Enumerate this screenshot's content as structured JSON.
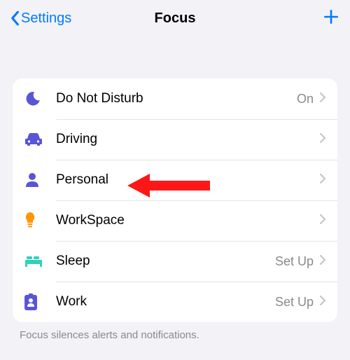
{
  "nav": {
    "back": "Settings",
    "title": "Focus"
  },
  "rows": [
    {
      "label": "Do Not Disturb",
      "status": "On"
    },
    {
      "label": "Driving",
      "status": ""
    },
    {
      "label": "Personal",
      "status": ""
    },
    {
      "label": "WorkSpace",
      "status": ""
    },
    {
      "label": "Sleep",
      "status": "Set Up"
    },
    {
      "label": "Work",
      "status": "Set Up"
    }
  ],
  "footer": "Focus silences alerts and notifications.",
  "colors": {
    "accent": "#007aff",
    "moon": "#5856d6",
    "car": "#5856d6",
    "person": "#5856d6",
    "bulb": "#ff9500",
    "bed": "#30d1bc",
    "badge": "#5856d6"
  }
}
